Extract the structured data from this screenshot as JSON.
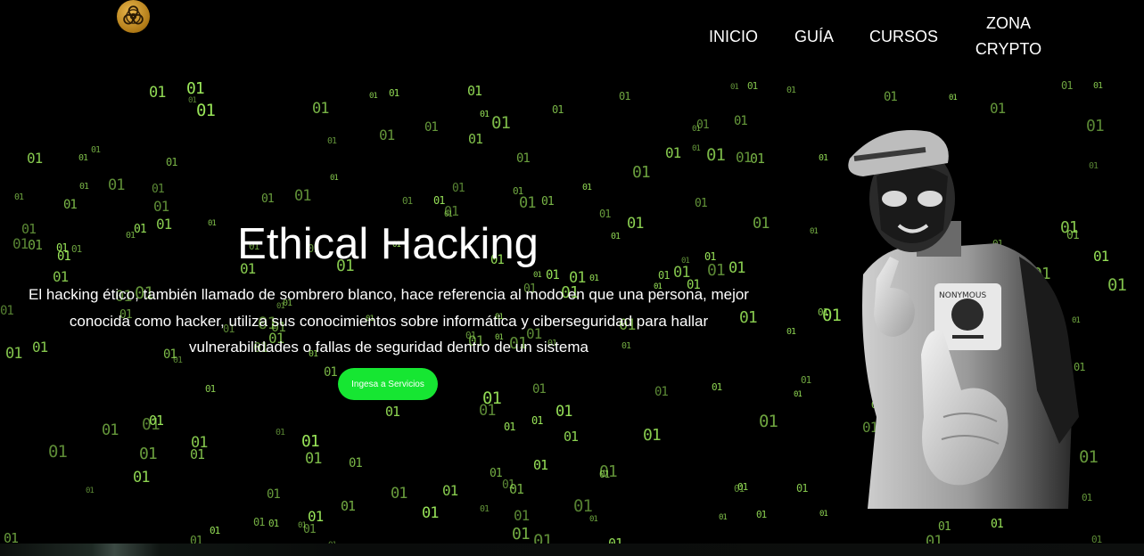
{
  "nav": {
    "logo_icon": "biohazard-icon",
    "items": [
      {
        "label": "INICIO"
      },
      {
        "label": "GUÍA"
      },
      {
        "label": "CURSOS"
      },
      {
        "label_line1": "ZONA",
        "label_line2": "CRYPTO"
      }
    ]
  },
  "hero": {
    "title": "Ethical Hacking",
    "description_lines": [
      "El hacking ético, también llamado de sombrero blanco, hace referencia al modo en que una persona, mejor",
      "conocida como hacker, utiliza sus conocimientos sobre informática y ciberseguridad para hallar",
      "vulnerabilidades o fallas de seguridad dentro de un sistema"
    ],
    "cta_label": "Ingesa a Servicios",
    "image_icon": "anonymous-hacker-photo"
  },
  "background": {
    "glyph": "01",
    "glyph_color": "#9be85a",
    "background_color": "#000000"
  },
  "colors": {
    "cta": "#16e632",
    "logo": "#d4a23a"
  }
}
